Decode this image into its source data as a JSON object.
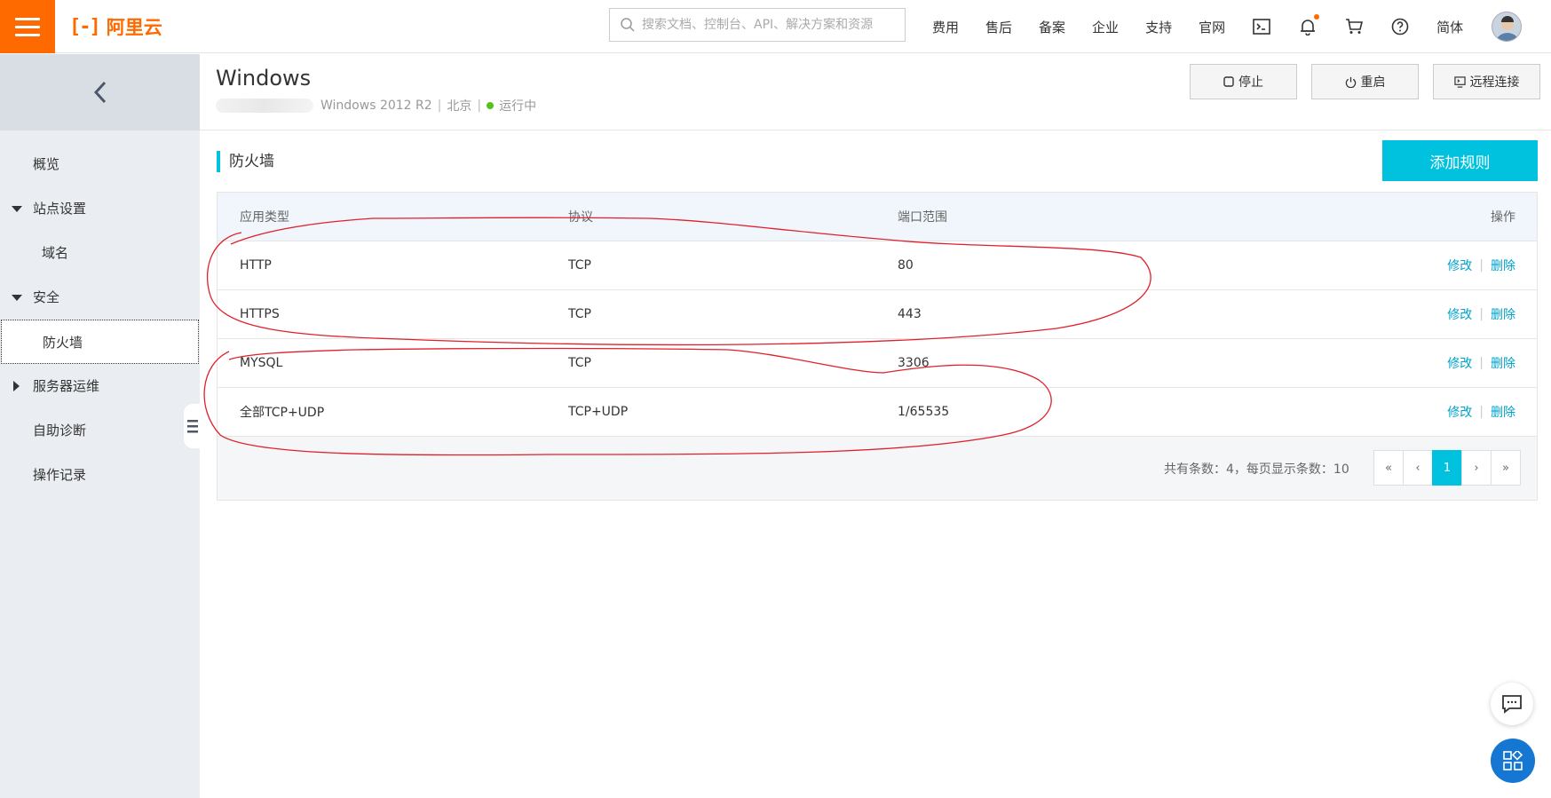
{
  "topbar": {
    "brand": "阿里云",
    "brand_mark": "[-]",
    "search_placeholder": "搜索文档、控制台、API、解决方案和资源",
    "nav": [
      "费用",
      "售后",
      "备案",
      "企业",
      "支持",
      "官网"
    ],
    "language": "简体"
  },
  "sidebar": {
    "items": [
      {
        "label": "概览"
      },
      {
        "label": "站点设置"
      },
      {
        "label": "域名"
      },
      {
        "label": "安全"
      },
      {
        "label": "防火墙"
      },
      {
        "label": "服务器运维"
      },
      {
        "label": "自助诊断"
      },
      {
        "label": "操作记录"
      }
    ]
  },
  "instance": {
    "title": "Windows",
    "os": "Windows 2012 R2",
    "region": "北京",
    "status": "运行中",
    "status_color": "#52c41a",
    "buttons": {
      "stop": "停止",
      "restart": "重启",
      "remote": "远程连接"
    }
  },
  "firewall": {
    "title": "防火墙",
    "add_button": "添加规则",
    "columns": [
      "应用类型",
      "协议",
      "端口范围",
      "操作"
    ],
    "rows": [
      {
        "app": "HTTP",
        "protocol": "TCP",
        "port": "80",
        "edit": "修改",
        "delete": "删除"
      },
      {
        "app": "HTTPS",
        "protocol": "TCP",
        "port": "443",
        "edit": "修改",
        "delete": "删除"
      },
      {
        "app": "MYSQL",
        "protocol": "TCP",
        "port": "3306",
        "edit": "修改",
        "delete": "删除"
      },
      {
        "app": "全部TCP+UDP",
        "protocol": "TCP+UDP",
        "port": "1/65535",
        "edit": "修改",
        "delete": "删除"
      }
    ],
    "pager_info": "共有条数：4，每页显示条数：10",
    "pager": {
      "first": "«",
      "prev": "‹",
      "current": "1",
      "next": "›",
      "last": "»"
    }
  },
  "colors": {
    "brand": "#ff6a00",
    "accent": "#00c1de",
    "link": "#00a2ca",
    "annotation": "#e0202a"
  }
}
